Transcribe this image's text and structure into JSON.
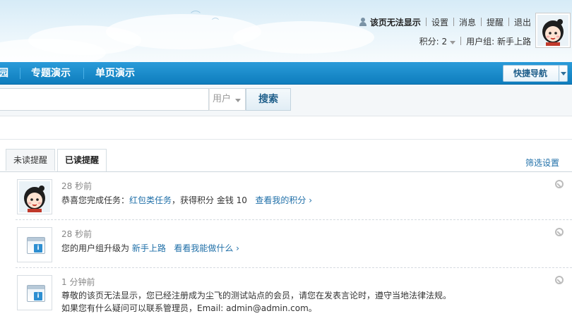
{
  "header": {
    "username": "该页无法显示",
    "links": [
      "设置",
      "消息",
      "提醒",
      "退出"
    ],
    "points_label": "积分: 2",
    "usergroup_label": "用户组: 新手上路"
  },
  "nav": {
    "items": [
      "园",
      "专题演示",
      "单页演示"
    ],
    "quick_nav": "快捷导航"
  },
  "search": {
    "value": "",
    "type": "用户",
    "button": "搜索"
  },
  "tabs": [
    {
      "label": "未读提醒",
      "active": false
    },
    {
      "label": "已读提醒",
      "active": true
    }
  ],
  "filter_settings": "筛选设置",
  "notices": [
    {
      "time": "28 秒前",
      "prefix": "恭喜您完成任务：",
      "task_link": "红包类任务",
      "middle": "，获得积分 金钱 10",
      "action_link": "查看我的积分 ›"
    },
    {
      "time": "28 秒前",
      "prefix": "您的用户组升级为",
      "group_link": "新手上路",
      "action_link": "看看我能做什么 ›"
    },
    {
      "time": "1 分钟前",
      "line1": "尊敬的该页无法显示，您已经注册成为尘飞的测试站点的会员，请您在发表言论时，遵守当地法律法规。",
      "line2": "如果您有什么疑问可以联系管理员，Email: admin@admin.com。"
    }
  ],
  "colors": {
    "nav_blue": "#1a8acb",
    "link_blue": "#1f6fa8"
  }
}
